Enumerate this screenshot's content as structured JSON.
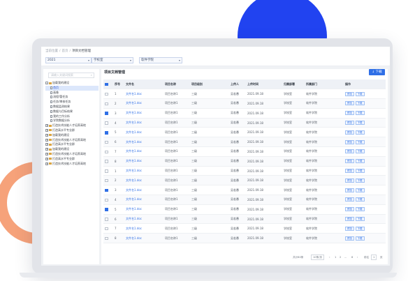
{
  "breadcrumb": [
    "当前位置",
    "首页",
    "项目文档管理"
  ],
  "filters": [
    {
      "value": "2021"
    },
    {
      "value": "学校室"
    },
    {
      "value": "软件学院"
    }
  ],
  "sidebar": {
    "search_placeholder": "请输入关键词搜索",
    "tree": [
      {
        "label": "加载我的建设",
        "expand": "-",
        "kind": "folder",
        "depth": 0
      },
      {
        "label": "首页",
        "expand": "",
        "kind": "doc",
        "depth": 1,
        "selected": true
      },
      {
        "label": "画像",
        "expand": "",
        "kind": "doc",
        "depth": 1
      },
      {
        "label": "流程/管任务",
        "expand": "",
        "kind": "doc",
        "depth": 1
      },
      {
        "label": "任务/审核任务",
        "expand": "",
        "kind": "doc",
        "depth": 1
      },
      {
        "label": "数据监测结果",
        "expand": "",
        "kind": "doc",
        "depth": 1
      },
      {
        "label": "数据与目标结果",
        "expand": "",
        "kind": "doc",
        "depth": 1
      },
      {
        "label": "我的工作分析",
        "expand": "",
        "kind": "doc",
        "depth": 1
      },
      {
        "label": "学院数据分析",
        "expand": "",
        "kind": "doc",
        "depth": 1
      },
      {
        "label": "打造技术技能人才培养高地",
        "expand": "+",
        "kind": "folder",
        "depth": 0
      },
      {
        "label": "打造高水平专业群",
        "expand": "+",
        "kind": "folder",
        "depth": 0
      },
      {
        "label": "加载我的建设",
        "expand": "+",
        "kind": "folder",
        "depth": 0
      },
      {
        "label": "打造技术技能人才培养高地",
        "expand": "+",
        "kind": "folder",
        "depth": 0
      },
      {
        "label": "打造高水平专业群",
        "expand": "+",
        "kind": "folder",
        "depth": 0
      },
      {
        "label": "加载我的建设",
        "expand": "+",
        "kind": "folder",
        "depth": 0
      },
      {
        "label": "打造技术技能人才培养高地",
        "expand": "+",
        "kind": "folder",
        "depth": 0
      },
      {
        "label": "打造高水平专业群",
        "expand": "+",
        "kind": "folder",
        "depth": 0
      },
      {
        "label": "打造技术技能人才培养高地",
        "expand": "+",
        "kind": "folder",
        "depth": 0
      }
    ]
  },
  "main": {
    "title": "项目文档管理",
    "download_all": "↓ 下载",
    "columns": [
      "",
      "序号",
      "文件名",
      "项目名称",
      "项目级别",
      "上传人",
      "上传时间",
      "归属部署",
      "所属部门",
      "操作"
    ],
    "rows": [
      {
        "checked": false,
        "no": "1",
        "file": "文件名1.doc",
        "project": "项目名称1",
        "level": "三级",
        "uploader": "吴若愚",
        "time": "2021.09.18",
        "owner": "学校室",
        "dept": "软件学院"
      },
      {
        "checked": false,
        "no": "2",
        "file": "文件名1.doc",
        "project": "项目名称1",
        "level": "三级",
        "uploader": "吴若愚",
        "time": "2021.09.18",
        "owner": "学校室",
        "dept": "软件学院"
      },
      {
        "checked": true,
        "no": "3",
        "file": "文件名1.doc",
        "project": "项目名称1",
        "level": "三级",
        "uploader": "吴若愚",
        "time": "2021.09.18",
        "owner": "学校室",
        "dept": "软件学院"
      },
      {
        "checked": false,
        "no": "4",
        "file": "文件名1.doc",
        "project": "项目名称1",
        "level": "三级",
        "uploader": "吴若愚",
        "time": "2021.09.18",
        "owner": "学校室",
        "dept": "软件学院"
      },
      {
        "checked": true,
        "no": "5",
        "file": "文件名1.doc",
        "project": "项目名称1",
        "level": "三级",
        "uploader": "吴若愚",
        "time": "2021.09.18",
        "owner": "学校室",
        "dept": "软件学院"
      },
      {
        "checked": false,
        "no": "6",
        "file": "文件名1.doc",
        "project": "项目名称1",
        "level": "三级",
        "uploader": "吴若愚",
        "time": "2021.09.18",
        "owner": "学校室",
        "dept": "软件学院"
      },
      {
        "checked": false,
        "no": "7",
        "file": "文件名1.doc",
        "project": "项目名称1",
        "level": "三级",
        "uploader": "吴若愚",
        "time": "2021.09.18",
        "owner": "学校室",
        "dept": "软件学院"
      },
      {
        "checked": false,
        "no": "8",
        "file": "文件名1.doc",
        "project": "项目名称1",
        "level": "三级",
        "uploader": "吴若愚",
        "time": "2021.09.18",
        "owner": "学校室",
        "dept": "软件学院"
      },
      {
        "checked": false,
        "no": "1",
        "file": "文件名1.doc",
        "project": "项目名称1",
        "level": "三级",
        "uploader": "吴若愚",
        "time": "2021.09.18",
        "owner": "学校室",
        "dept": "软件学院"
      },
      {
        "checked": false,
        "no": "2",
        "file": "文件名1.doc",
        "project": "项目名称1",
        "level": "三级",
        "uploader": "吴若愚",
        "time": "2021.09.18",
        "owner": "学校室",
        "dept": "软件学院"
      },
      {
        "checked": true,
        "no": "3",
        "file": "文件名1.doc",
        "project": "项目名称1",
        "level": "三级",
        "uploader": "吴若愚",
        "time": "2021.09.18",
        "owner": "学校室",
        "dept": "软件学院"
      },
      {
        "checked": false,
        "no": "4",
        "file": "文件名1.doc",
        "project": "项目名称1",
        "level": "三级",
        "uploader": "吴若愚",
        "time": "2021.09.18",
        "owner": "学校室",
        "dept": "软件学院"
      },
      {
        "checked": true,
        "no": "5",
        "file": "文件名1.doc",
        "project": "项目名称1",
        "level": "三级",
        "uploader": "吴若愚",
        "time": "2021.09.18",
        "owner": "学校室",
        "dept": "软件学院"
      },
      {
        "checked": false,
        "no": "6",
        "file": "文件名1.doc",
        "project": "项目名称1",
        "level": "三级",
        "uploader": "吴若愚",
        "time": "2021.09.18",
        "owner": "学校室",
        "dept": "软件学院"
      },
      {
        "checked": false,
        "no": "7",
        "file": "文件名1.doc",
        "project": "项目名称1",
        "level": "三级",
        "uploader": "吴若愚",
        "time": "2021.09.18",
        "owner": "学校室",
        "dept": "软件学院"
      },
      {
        "checked": false,
        "no": "8",
        "file": "文件名1.doc",
        "project": "项目名称1",
        "level": "三级",
        "uploader": "吴若愚",
        "time": "2021.09.18",
        "owner": "学校室",
        "dept": "软件学院"
      }
    ],
    "row_actions": [
      "预览",
      "下载"
    ]
  },
  "pagination": {
    "total": "共计80条",
    "page_size": "10条/页",
    "pages": [
      "1",
      "2",
      "...",
      "8"
    ],
    "jump_label": "前往",
    "jump_value": "1",
    "jump_suffix": "页"
  },
  "colors": {
    "accent": "#2f6fe6",
    "blue_decor": "#2143f0",
    "orange_decor": "#f6a27a"
  },
  "icons": {
    "select_arrow": "▾",
    "search": "⌕",
    "tree_folder": "folder-icon",
    "tree_doc": "document-icon"
  }
}
